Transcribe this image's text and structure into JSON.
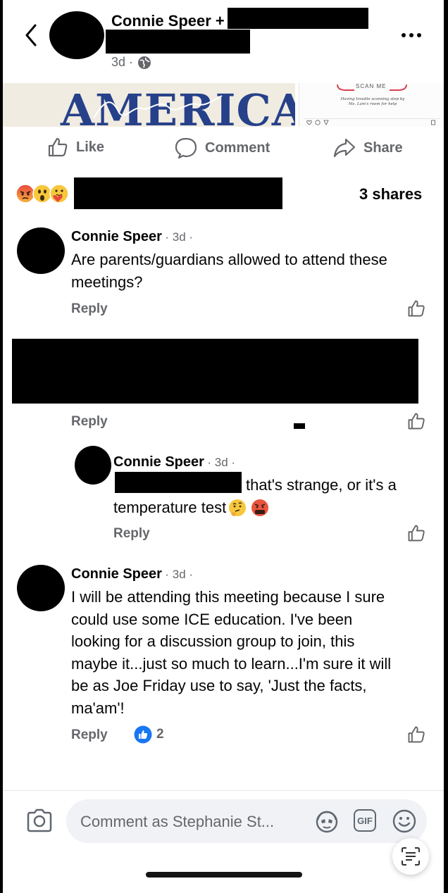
{
  "post": {
    "author": "Connie Speer +",
    "time": "3d ·"
  },
  "preview": {
    "left_art": "AMERICA",
    "scan_label": "SCAN ME",
    "scan_caption": "Having trouble scanning step by Ms. Lam's room for help"
  },
  "actions": {
    "like": "Like",
    "comment": "Comment",
    "share": "Share"
  },
  "reactions": {
    "shares": "3 shares"
  },
  "comments": [
    {
      "name": "Connie Speer",
      "time": "· 3d ·",
      "text_line1": "Are parents/guardians allowed to attend these",
      "text_line2": "meetings?",
      "reply": "Reply"
    },
    {
      "reply": "Reply"
    },
    {
      "name": "Connie Speer",
      "time": "· 3d ·",
      "text_line1": "that's strange, or it's a",
      "text_line2": "temperature test",
      "reply": "Reply"
    },
    {
      "name": "Connie Speer",
      "time": "· 3d ·",
      "text": [
        "I will be attending this meeting because I sure",
        "could use some ICE education. I've been",
        "looking for a discussion group to join, this",
        "maybe it...just so much to learn...I'm sure it will",
        "be as Joe Friday use to say, 'Just the facts,",
        "ma'am'!"
      ],
      "reply": "Reply",
      "like_count": "2"
    }
  ],
  "composer": {
    "placeholder": "Comment as Stephanie St...",
    "gif": "GIF"
  },
  "colors": {
    "facebook_blue": "#1877f2",
    "secondary_text": "#65676b",
    "composer_bg": "#f0f2f5"
  }
}
